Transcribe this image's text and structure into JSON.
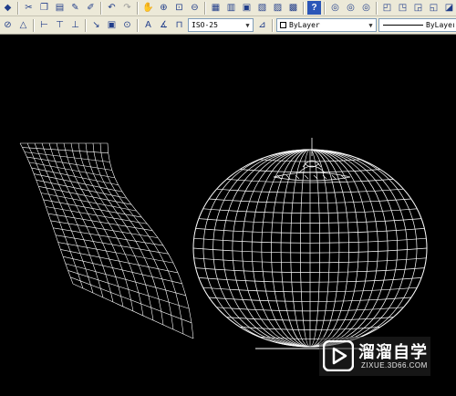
{
  "toolbar_top": {
    "icons": [
      "properties-icon",
      "cut-icon",
      "copy-icon",
      "paste-icon",
      "match-properties-icon",
      "brush-icon",
      "undo-icon",
      "redo-icon",
      "pan-icon",
      "zoom-realtime-icon",
      "zoom-window-icon",
      "zoom-previous-icon",
      "properties-palette-icon",
      "design-center-icon",
      "tool-palettes-icon",
      "sheet-set-icon",
      "markup-icon",
      "quickcalc-icon",
      "help-icon",
      "layer-state-icon",
      "layer-prev-icon",
      "layer-next-icon",
      "3d-orbit-icon",
      "view-icon",
      "render-icon",
      "shade-icon",
      "camera-icon"
    ]
  },
  "toolbar_dims": {
    "dim_style_value": "ISO-25",
    "color_value": "ByLayer",
    "linetype_value": "ByLayer"
  },
  "watermark": {
    "title": "溜溜自学",
    "url": "ZIXUE.3D66.COM"
  },
  "colors": {
    "toolbar_bg": "#ece9d8",
    "canvas_bg": "#000000",
    "wireframe": "#ffffff"
  }
}
